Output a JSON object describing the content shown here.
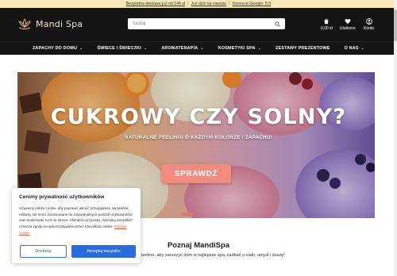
{
  "topbar": {
    "free_shipping": "Bezpłatna dostawa już od 149 zł",
    "gift": "Już dziś na zawsze",
    "rating": "Ocena w Google: 5.0",
    "separator": "|"
  },
  "header": {
    "logo_text": "Mandi Spa",
    "search_placeholder": "Szukaj",
    "cart_label": "0,00 zł",
    "wishlist_label": "Ulubione",
    "account_label": "Konto"
  },
  "nav": {
    "items": [
      {
        "label": "ZAPACHY DO DOMU",
        "chevron": "⌄"
      },
      {
        "label": "ŚWIECE I ŚWIECZKI",
        "chevron": "⌄"
      },
      {
        "label": "AROMATERAPIA",
        "chevron": "⌄"
      },
      {
        "label": "KOSMETYKI SPA",
        "chevron": "⌄"
      },
      {
        "label": "ZESTAWY PREZENTOWE",
        "chevron": ""
      },
      {
        "label": "O NAS",
        "chevron": "⌄"
      }
    ]
  },
  "hero": {
    "title": "CUKROWY CZY SOLNY?",
    "subtitle": "NATURALNE PEELINGI O KAŻDYM KOLORZE I ZAPACHU!",
    "button": "SPRAWDŹ"
  },
  "intro": {
    "title": "Poznaj MandiSpa",
    "text": "otrzebne, aby zanurzyć dom w najlepsze spa, zadbać o ciało, umysł i duszę!"
  },
  "cookie": {
    "title": "Cenimy prywatność użytkowników",
    "text": "Używamy plików cookie, aby poprawić jakość przeglądania, wyświetlać reklamy lub treści dostosowane do indywidualnych potrzeb użytkowników oraz analizować ruch na stronie. Kliknięcie przycisku „Akceptuj wszystkie” oznacza zgodę na wykorzystywanie przez nas plików cookie.",
    "policy_link": "Polityka Cookie",
    "settings_button": "Dostosuj",
    "accept_button": "Akceptuj wszystko"
  },
  "colors": {
    "header_bg": "#141414",
    "topbar_bg": "#f6e9b8",
    "accent_button": "#f08b7d",
    "accept_blue": "#2b6bdb",
    "logo_gold": "#d9b26a"
  },
  "icons": [
    "lotus-logo-icon",
    "search-icon",
    "cart-icon",
    "heart-icon",
    "user-icon",
    "chevron-down-icon"
  ]
}
